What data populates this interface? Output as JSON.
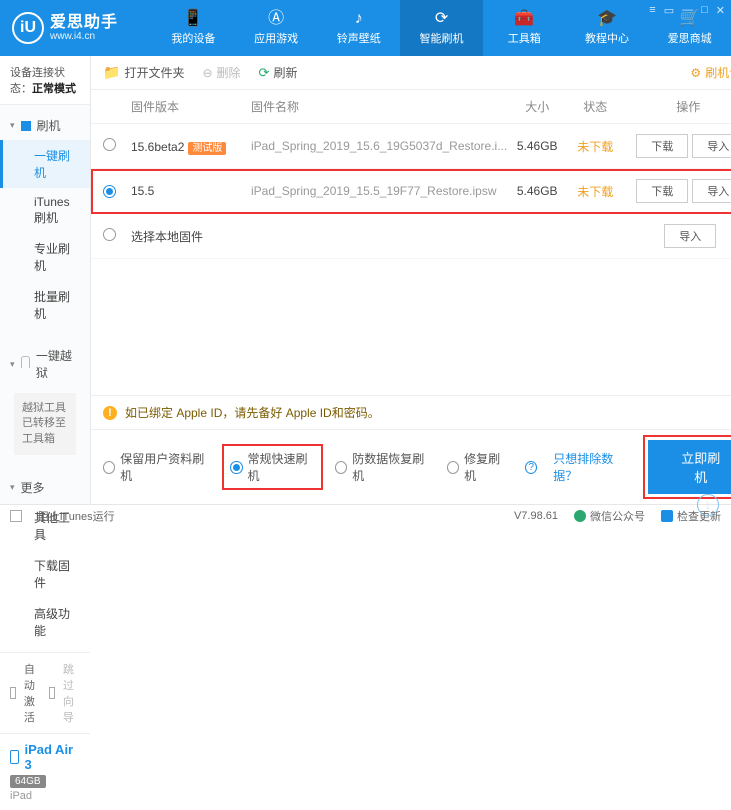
{
  "brand": {
    "cn": "爱思助手",
    "url": "www.i4.cn",
    "glyph": "iU"
  },
  "nav": [
    {
      "label": "我的设备",
      "glyph": "📱"
    },
    {
      "label": "应用游戏",
      "glyph": "Ⓐ"
    },
    {
      "label": "铃声壁纸",
      "glyph": "♪"
    },
    {
      "label": "智能刷机",
      "glyph": "⟳"
    },
    {
      "label": "工具箱",
      "glyph": "🧰"
    },
    {
      "label": "教程中心",
      "glyph": "🎓"
    },
    {
      "label": "爱思商城",
      "glyph": "🛒"
    }
  ],
  "conn": {
    "prefix": "设备连接状态：",
    "value": "正常模式"
  },
  "side": {
    "flash": {
      "head": "刷机",
      "items": [
        "一键刷机",
        "iTunes刷机",
        "专业刷机",
        "批量刷机"
      ]
    },
    "jb": {
      "head": "一键越狱",
      "note": "越狱工具已转移至工具箱"
    },
    "more": {
      "head": "更多",
      "items": [
        "其他工具",
        "下载固件",
        "高级功能"
      ]
    }
  },
  "opts": {
    "auto": "自动激活",
    "skip": "跳过向导"
  },
  "device": {
    "name": "iPad Air 3",
    "cap": "64GB",
    "type": "iPad"
  },
  "toolbar": {
    "open": "打开文件夹",
    "del": "删除",
    "refresh": "刷新",
    "settings": "刷机设置"
  },
  "cols": {
    "ver": "固件版本",
    "name": "固件名称",
    "size": "大小",
    "stat": "状态",
    "ops": "操作"
  },
  "rows": [
    {
      "ver": "15.6beta2",
      "beta": "测试版",
      "name": "iPad_Spring_2019_15.6_19G5037d_Restore.i...",
      "size": "5.46GB",
      "stat": "未下载",
      "sel": false
    },
    {
      "ver": "15.5",
      "beta": "",
      "name": "iPad_Spring_2019_15.5_19F77_Restore.ipsw",
      "size": "5.46GB",
      "stat": "未下载",
      "sel": true
    }
  ],
  "local": "选择本地固件",
  "btns": {
    "dl": "下载",
    "imp": "导入"
  },
  "notice": "如已绑定 Apple ID，请先备好 Apple ID和密码。",
  "modes": {
    "keep": "保留用户资料刷机",
    "normal": "常规快速刷机",
    "dfu": "防数据恢复刷机",
    "repair": "修复刷机",
    "exclude": "只想排除数据？"
  },
  "flash": "立即刷机",
  "footer": {
    "block": "阻止iTunes运行",
    "ver": "V7.98.61",
    "wx": "微信公众号",
    "upd": "检查更新"
  }
}
